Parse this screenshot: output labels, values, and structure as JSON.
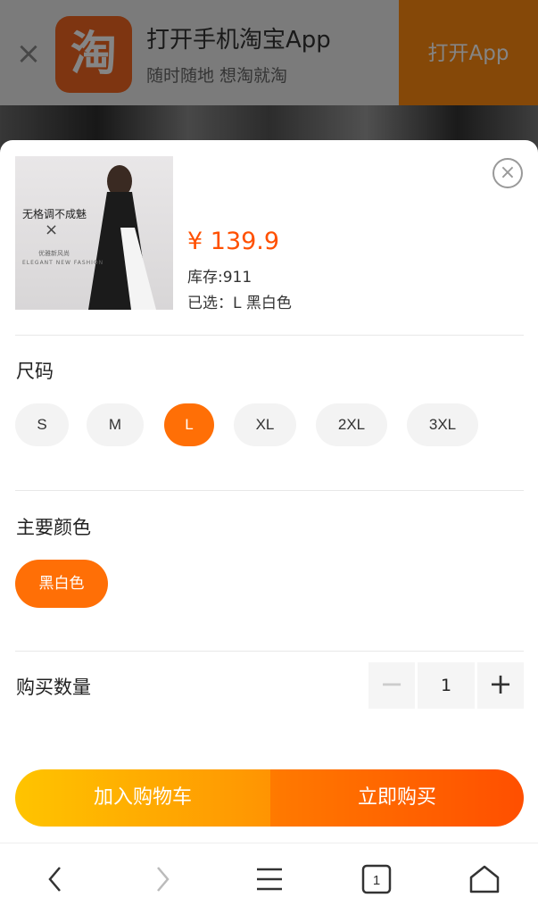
{
  "banner": {
    "logo_text": "淘",
    "title": "打开手机淘宝App",
    "subtitle": "随时随地 想淘就淘",
    "open_button": "打开App",
    "close_icon": "close-icon"
  },
  "product": {
    "price": "¥ 139.9",
    "stock": "库存:911",
    "selected": "已选：L 黑白色",
    "thumb_text": {
      "line1": "无格调不成魅",
      "line2": "×",
      "line3": "优雅新风尚",
      "line4": "ELEGANT NEW FASHION"
    }
  },
  "size": {
    "title": "尺码",
    "options": [
      "S",
      "M",
      "L",
      "XL",
      "2XL",
      "3XL"
    ],
    "selected": "L"
  },
  "color": {
    "title": "主要颜色",
    "options": [
      "黑白色"
    ],
    "selected": "黑白色"
  },
  "quantity": {
    "label": "购买数量",
    "value": "1",
    "minus": "−",
    "plus": "+"
  },
  "actions": {
    "add_to_cart": "加入购物车",
    "buy_now": "立即购买"
  },
  "browser_nav": {
    "tab_count": "1",
    "icons": [
      "back-icon",
      "forward-icon",
      "menu-icon",
      "tabs-icon",
      "home-icon"
    ]
  },
  "colors": {
    "accent": "#ff6f06",
    "price": "#ff5000",
    "cart_gradient": [
      "#ffc400",
      "#ff9402"
    ],
    "buy_gradient": [
      "#ff7a00",
      "#ff4f00"
    ]
  }
}
